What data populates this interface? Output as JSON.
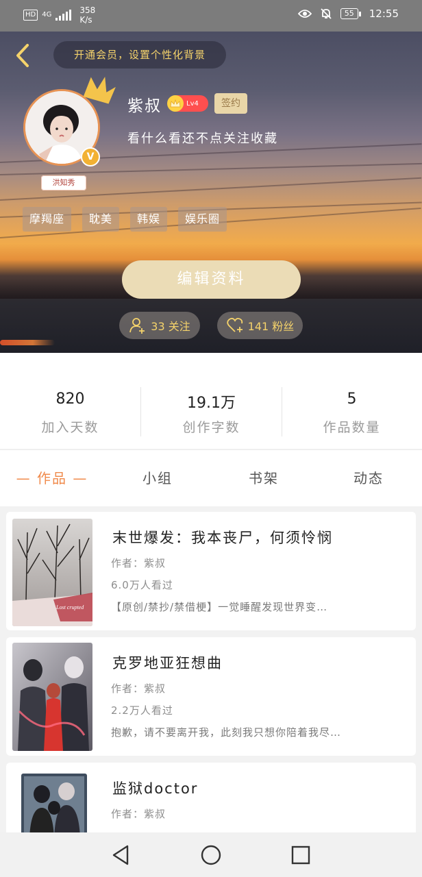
{
  "status_bar": {
    "network_badge": "HD",
    "network_type": "4G",
    "speed_value": "358",
    "speed_unit": "K/s",
    "battery": "55",
    "time": "12:55"
  },
  "header": {
    "vip_prompt": "开通会员，设置个性化背景",
    "avatar_tag": "洪知秀",
    "verified_badge": "V",
    "username": "紫叔",
    "level": "Lv4",
    "sign_tag": "签约",
    "bio": "看什么看还不点关注收藏",
    "tags": [
      "摩羯座",
      "耽美",
      "韩娱",
      "娱乐圈"
    ],
    "edit_button": "编辑资料",
    "following": "33 关注",
    "followers": "141 粉丝"
  },
  "stats": [
    {
      "value": "820",
      "label": "加入天数"
    },
    {
      "value": "19.1万",
      "label": "创作字数"
    },
    {
      "value": "5",
      "label": "作品数量"
    }
  ],
  "tabs": [
    {
      "label": "— 作品 —",
      "active": true
    },
    {
      "label": "小组",
      "active": false
    },
    {
      "label": "书架",
      "active": false
    },
    {
      "label": "动态",
      "active": false
    }
  ],
  "works": [
    {
      "title": "末世爆发：我本丧尸，何须怜悯",
      "author": "作者：紫叔",
      "views": "6.0万人看过",
      "desc": "【原创/禁抄/禁借梗】一觉睡醒发现世界变…",
      "cover_text": "Lost crupted"
    },
    {
      "title": "克罗地亚狂想曲",
      "author": "作者：紫叔",
      "views": "2.2万人看过",
      "desc": "抱歉，请不要离开我，此刻我只想你陪着我尽…",
      "cover_text": ""
    },
    {
      "title": "监狱doctor",
      "author": "作者：紫叔",
      "views": "",
      "desc": "",
      "cover_text": ""
    }
  ],
  "colors": {
    "accent": "#f08a4b",
    "gold": "#f5d36b",
    "edit_button": "#ebdcb6"
  }
}
